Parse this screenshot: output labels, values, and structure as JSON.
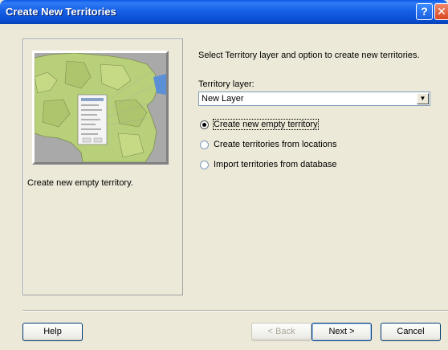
{
  "window": {
    "title": "Create New Territories",
    "help_glyph": "?",
    "close_glyph": "✕"
  },
  "left_panel": {
    "description": "Create new empty territory."
  },
  "main": {
    "instructions": "Select Territory layer and option to create new territories.",
    "territory_layer_label": "Territory layer:",
    "territory_layer_value": "New Layer",
    "options": [
      {
        "label": "Create new empty territory",
        "selected": true
      },
      {
        "label": "Create territories from locations",
        "selected": false
      },
      {
        "label": "Import territories from database",
        "selected": false
      }
    ]
  },
  "buttons": {
    "help": "Help",
    "back": "< Back",
    "next": "Next >",
    "cancel": "Cancel"
  },
  "colors": {
    "titlebar": "#0b4fd6",
    "dialog_bg": "#ece9d8",
    "map_land": "#b9d07a",
    "map_water": "#a9a9a9"
  }
}
